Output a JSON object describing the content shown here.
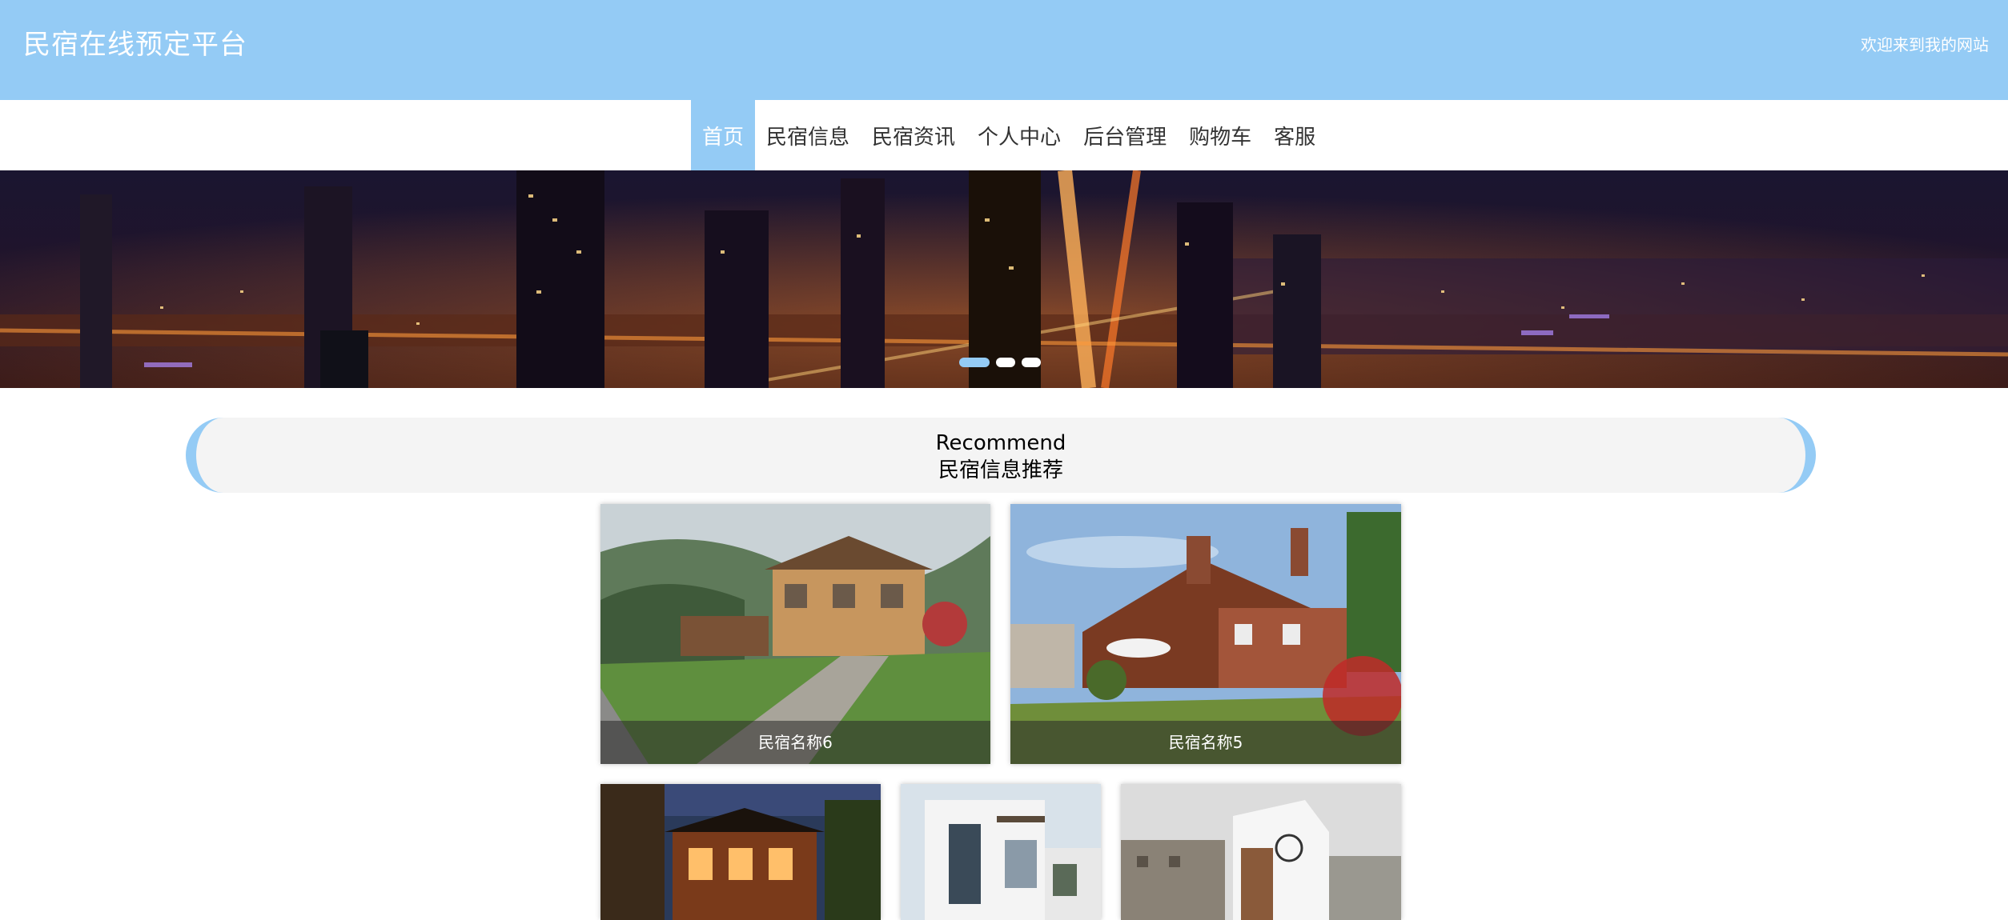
{
  "header": {
    "title": "民宿在线预定平台",
    "welcome": "欢迎来到我的网站"
  },
  "nav": {
    "items": [
      {
        "label": "首页",
        "active": true
      },
      {
        "label": "民宿信息",
        "active": false
      },
      {
        "label": "民宿资讯",
        "active": false
      },
      {
        "label": "个人中心",
        "active": false
      },
      {
        "label": "后台管理",
        "active": false
      },
      {
        "label": "购物车",
        "active": false
      },
      {
        "label": "客服",
        "active": false
      }
    ]
  },
  "banner": {
    "image": "night-city-skyline",
    "slide_count": 3,
    "active_slide": 1
  },
  "recommend": {
    "title_en": "Recommend",
    "title_cn": "民宿信息推荐",
    "cards": [
      {
        "name": "民宿名称6",
        "image": "wooden-villa-with-garden"
      },
      {
        "name": "民宿名称5",
        "image": "brick-cottage-with-terrace"
      },
      {
        "name": "",
        "image": "courtyard-at-dusk"
      },
      {
        "name": "",
        "image": "modern-white-house"
      },
      {
        "name": "",
        "image": "seaside-village-house"
      }
    ]
  },
  "colors": {
    "accent": "#94cbf5",
    "nav_text": "#333333",
    "section_bg": "#f4f4f4"
  }
}
